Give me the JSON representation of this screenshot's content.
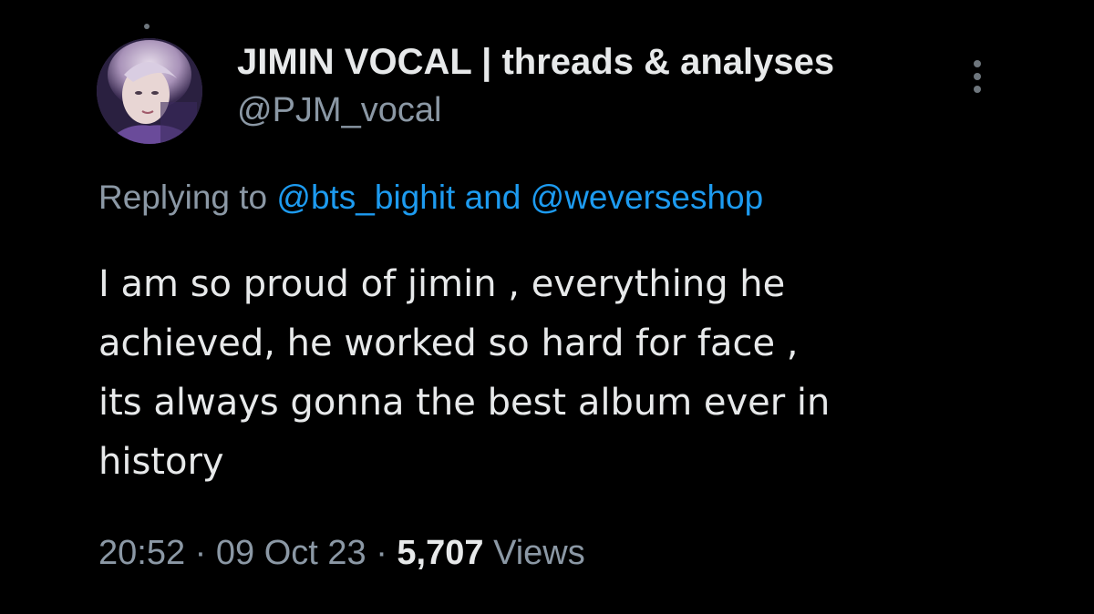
{
  "author": {
    "display_name": "JIMIN VOCAL | threads & analyses",
    "handle": "@PJM_vocal"
  },
  "reply": {
    "prefix": "Replying to ",
    "mention_1": "@bts_bighit",
    "conjunction": " and ",
    "mention_2": "@weverseshop"
  },
  "tweet": {
    "lines": [
      "I am so proud of jimin , everything he",
      "achieved, he worked so hard for face ,",
      "its always gonna the best album ever in",
      "history"
    ]
  },
  "meta": {
    "time": "20:52",
    "separator_1": " · ",
    "date": "09 Oct 23",
    "separator_2": " · ",
    "views_count": "5,707",
    "views_label": " Views"
  },
  "colors": {
    "background": "#000000",
    "primary_text": "#e7e9ea",
    "secondary_text": "#8b98a5",
    "link": "#1d9bf0"
  },
  "icons": {
    "more": "more-dots-vertical-icon"
  }
}
